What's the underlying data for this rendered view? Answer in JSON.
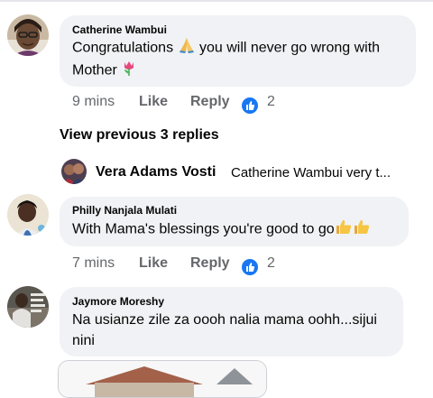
{
  "comments": [
    {
      "author": "Catherine Wambui",
      "text_before": "Congratulations ",
      "text_after": " you will never go wrong with Mother ",
      "emojis": [
        "folded-hands-emoji",
        "tulip-emoji"
      ],
      "time": "9 mins",
      "like_label": "Like",
      "reply_label": "Reply",
      "reaction_count": "2"
    },
    {
      "author": "Philly Nanjala Mulati",
      "text": "With Mama's blessings you're good to go",
      "emojis": [
        "thumbs-up-emoji",
        "thumbs-up-emoji"
      ],
      "time": "7 mins",
      "like_label": "Like",
      "reply_label": "Reply",
      "reaction_count": "2"
    },
    {
      "author": "Jaymore Moreshy",
      "text": "Na usianze zile za oooh nalia mama oohh...sijui nini"
    }
  ],
  "view_previous": "View previous 3 replies",
  "reply_preview": {
    "author": "Vera Adams Vosti",
    "snippet": "Catherine Wambui very t..."
  },
  "colors": {
    "bubble": "#f0f2f5",
    "meta_text": "#65676b",
    "like_blue": "#1877f2"
  }
}
